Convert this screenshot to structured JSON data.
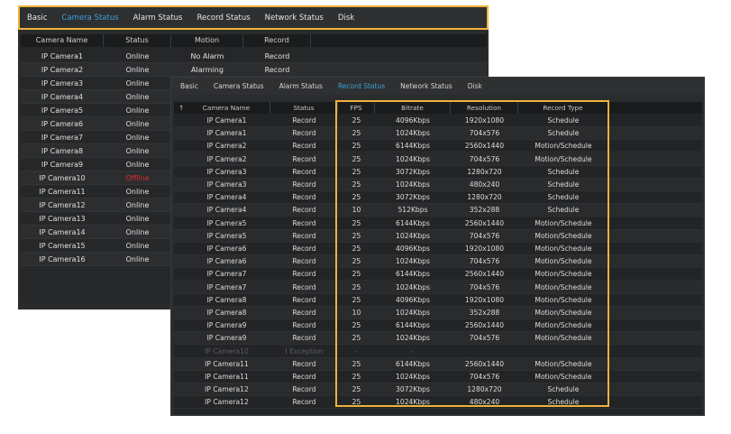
{
  "highlight_color": "#f0b23a",
  "accent_color": "#3aa3d8",
  "offline_color": "#e02a2a",
  "back_window": {
    "tabs": [
      {
        "label": "Basic",
        "active": false
      },
      {
        "label": "Camera Status",
        "active": true
      },
      {
        "label": "Alarm Status",
        "active": false
      },
      {
        "label": "Record Status",
        "active": false
      },
      {
        "label": "Network Status",
        "active": false
      },
      {
        "label": "Disk",
        "active": false
      }
    ],
    "columns": [
      "Camera Name",
      "Status",
      "Motion",
      "Record"
    ],
    "rows": [
      {
        "name": "IP Camera1",
        "status": "Online",
        "motion": "No Alarm",
        "record": "Record"
      },
      {
        "name": "IP Camera2",
        "status": "Online",
        "motion": "Alarming",
        "record": "Record"
      },
      {
        "name": "IP Camera3",
        "status": "Online",
        "motion": "",
        "record": ""
      },
      {
        "name": "IP Camera4",
        "status": "Online",
        "motion": "",
        "record": ""
      },
      {
        "name": "IP Camera5",
        "status": "Online",
        "motion": "",
        "record": ""
      },
      {
        "name": "IP Camera6",
        "status": "Online",
        "motion": "",
        "record": ""
      },
      {
        "name": "IP Camera7",
        "status": "Online",
        "motion": "",
        "record": ""
      },
      {
        "name": "IP Camera8",
        "status": "Online",
        "motion": "",
        "record": ""
      },
      {
        "name": "IP Camera9",
        "status": "Online",
        "motion": "",
        "record": ""
      },
      {
        "name": "IP Camera10",
        "status": "Offline",
        "motion": "",
        "record": ""
      },
      {
        "name": "IP Camera11",
        "status": "Online",
        "motion": "",
        "record": ""
      },
      {
        "name": "IP Camera12",
        "status": "Online",
        "motion": "",
        "record": ""
      },
      {
        "name": "IP Camera13",
        "status": "Online",
        "motion": "",
        "record": ""
      },
      {
        "name": "IP Camera14",
        "status": "Online",
        "motion": "",
        "record": ""
      },
      {
        "name": "IP Camera15",
        "status": "Online",
        "motion": "",
        "record": ""
      },
      {
        "name": "IP Camera16",
        "status": "Online",
        "motion": "",
        "record": ""
      }
    ]
  },
  "front_window": {
    "tabs": [
      {
        "label": "Basic",
        "active": false
      },
      {
        "label": "Camera Status",
        "active": false
      },
      {
        "label": "Alarm Status",
        "active": false
      },
      {
        "label": "Record Status",
        "active": true
      },
      {
        "label": "Network Status",
        "active": false
      },
      {
        "label": "Disk",
        "active": false
      }
    ],
    "sort_icon": "sort-up-icon",
    "columns": [
      "Camera Name",
      "Status",
      "FPS",
      "Bitrate",
      "Resolution",
      "Record Type"
    ],
    "rows": [
      {
        "name": "IP Camera1",
        "status": "Record",
        "fps": "25",
        "bitrate": "4096Kbps",
        "resolution": "1920x1080",
        "type": "Schedule"
      },
      {
        "name": "IP Camera1",
        "status": "Record",
        "fps": "25",
        "bitrate": "1024Kbps",
        "resolution": "704x576",
        "type": "Schedule"
      },
      {
        "name": "IP Camera2",
        "status": "Record",
        "fps": "25",
        "bitrate": "6144Kbps",
        "resolution": "2560x1440",
        "type": "Motion/Schedule"
      },
      {
        "name": "IP Camera2",
        "status": "Record",
        "fps": "25",
        "bitrate": "1024Kbps",
        "resolution": "704x576",
        "type": "Motion/Schedule"
      },
      {
        "name": "IP Camera3",
        "status": "Record",
        "fps": "25",
        "bitrate": "3072Kbps",
        "resolution": "1280x720",
        "type": "Schedule"
      },
      {
        "name": "IP Camera3",
        "status": "Record",
        "fps": "25",
        "bitrate": "1024Kbps",
        "resolution": "480x240",
        "type": "Schedule"
      },
      {
        "name": "IP Camera4",
        "status": "Record",
        "fps": "25",
        "bitrate": "3072Kbps",
        "resolution": "1280x720",
        "type": "Schedule"
      },
      {
        "name": "IP Camera4",
        "status": "Record",
        "fps": "10",
        "bitrate": "512Kbps",
        "resolution": "352x288",
        "type": "Schedule"
      },
      {
        "name": "IP Camera5",
        "status": "Record",
        "fps": "25",
        "bitrate": "6144Kbps",
        "resolution": "2560x1440",
        "type": "Motion/Schedule"
      },
      {
        "name": "IP Camera5",
        "status": "Record",
        "fps": "25",
        "bitrate": "1024Kbps",
        "resolution": "704x576",
        "type": "Motion/Schedule"
      },
      {
        "name": "IP Camera6",
        "status": "Record",
        "fps": "25",
        "bitrate": "4096Kbps",
        "resolution": "1920x1080",
        "type": "Motion/Schedule"
      },
      {
        "name": "IP Camera6",
        "status": "Record",
        "fps": "25",
        "bitrate": "1024Kbps",
        "resolution": "704x576",
        "type": "Motion/Schedule"
      },
      {
        "name": "IP Camera7",
        "status": "Record",
        "fps": "25",
        "bitrate": "6144Kbps",
        "resolution": "2560x1440",
        "type": "Motion/Schedule"
      },
      {
        "name": "IP Camera7",
        "status": "Record",
        "fps": "25",
        "bitrate": "1024Kbps",
        "resolution": "704x576",
        "type": "Motion/Schedule"
      },
      {
        "name": "IP Camera8",
        "status": "Record",
        "fps": "25",
        "bitrate": "4096Kbps",
        "resolution": "1920x1080",
        "type": "Motion/Schedule"
      },
      {
        "name": "IP Camera8",
        "status": "Record",
        "fps": "10",
        "bitrate": "1024Kbps",
        "resolution": "352x288",
        "type": "Motion/Schedule"
      },
      {
        "name": "IP Camera9",
        "status": "Record",
        "fps": "25",
        "bitrate": "6144Kbps",
        "resolution": "2560x1440",
        "type": "Motion/Schedule"
      },
      {
        "name": "IP Camera9",
        "status": "Record",
        "fps": "25",
        "bitrate": "1024Kbps",
        "resolution": "704x576",
        "type": "Motion/Schedule"
      },
      {
        "name": "IP Camera10",
        "status": "I Exception",
        "fps": "-",
        "bitrate": "-",
        "resolution": "",
        "type": "",
        "dim": true
      },
      {
        "name": "IP Camera11",
        "status": "Record",
        "fps": "25",
        "bitrate": "6144Kbps",
        "resolution": "2560x1440",
        "type": "Motion/Schedule"
      },
      {
        "name": "IP Camera11",
        "status": "Record",
        "fps": "25",
        "bitrate": "1024Kbps",
        "resolution": "704x576",
        "type": "Motion/Schedule"
      },
      {
        "name": "IP Camera12",
        "status": "Record",
        "fps": "25",
        "bitrate": "3072Kbps",
        "resolution": "1280x720",
        "type": "Schedule"
      },
      {
        "name": "IP Camera12",
        "status": "Record",
        "fps": "25",
        "bitrate": "1024Kbps",
        "resolution": "480x240",
        "type": "Schedule"
      }
    ]
  }
}
